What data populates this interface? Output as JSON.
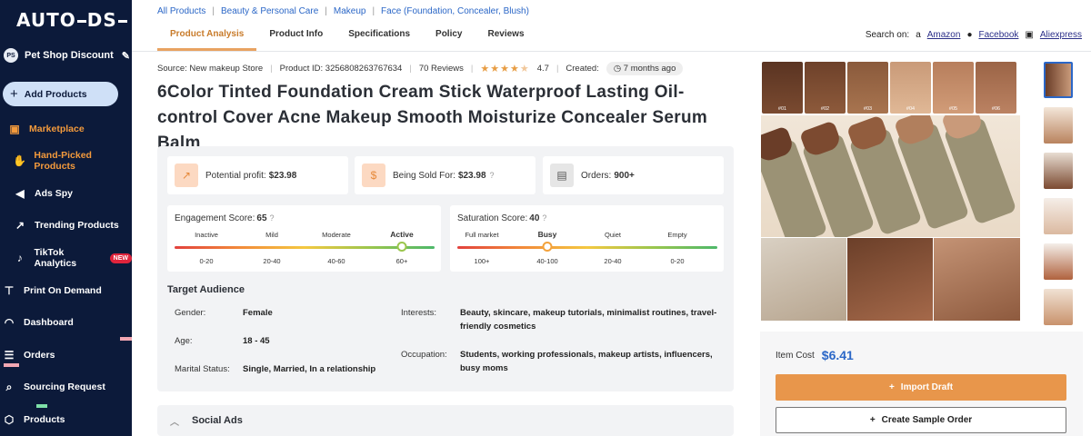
{
  "sidebar": {
    "logo_a": "AUTO",
    "logo_b": "DS",
    "store_badge": "PS",
    "store_name": "Pet Shop Discount",
    "add_products": "Add Products",
    "items": [
      {
        "label": "Marketplace",
        "icon": "bag-icon"
      },
      {
        "label": "Hand-Picked Products",
        "icon": "hand-icon"
      },
      {
        "label": "Ads Spy",
        "icon": "megaphone-icon"
      },
      {
        "label": "Trending Products",
        "icon": "trend-chart-icon"
      },
      {
        "label": "TikTok Analytics",
        "icon": "tiktok-icon",
        "badge": "NEW"
      },
      {
        "label": "Print On Demand",
        "icon": "shirt-icon"
      },
      {
        "label": "Dashboard",
        "icon": "gauge-icon"
      },
      {
        "label": "Orders",
        "icon": "orders-icon"
      },
      {
        "label": "Sourcing Request",
        "icon": "sourcing-icon"
      },
      {
        "label": "Products",
        "icon": "box-icon"
      }
    ]
  },
  "breadcrumb": [
    "All Products",
    "Beauty & Personal Care",
    "Makeup",
    "Face (Foundation, Concealer, Blush)"
  ],
  "tabs": [
    "Product Analysis",
    "Product Info",
    "Specifications",
    "Policy",
    "Reviews"
  ],
  "search_on": {
    "label": "Search on:",
    "sites": [
      "Amazon",
      "Facebook",
      "Aliexpress"
    ]
  },
  "meta": {
    "source": "Source: New makeup Store",
    "product_id": "Product ID: 3256808263767634",
    "reviews": "70 Reviews",
    "rating": "4.7",
    "created_label": "Created:",
    "created_value": "7 months ago"
  },
  "title": "6Color Tinted Foundation Cream Stick Waterproof Lasting Oil-control Cover Acne Makeup Smooth Moisturize Concealer Serum Balm",
  "metrics": {
    "profit_label": "Potential profit:",
    "profit_value": "$23.98",
    "sold_label": "Being Sold For:",
    "sold_value": "$23.98",
    "orders_label": "Orders:",
    "orders_value": "900+"
  },
  "engagement": {
    "label": "Engagement Score:",
    "value": "65",
    "levels": [
      "Inactive",
      "Mild",
      "Moderate",
      "Active"
    ],
    "ranges": [
      "0-20",
      "20-40",
      "40-60",
      "60+"
    ],
    "active_index": 3
  },
  "saturation": {
    "label": "Saturation Score:",
    "value": "40",
    "levels": [
      "Full market",
      "Busy",
      "Quiet",
      "Empty"
    ],
    "ranges": [
      "100+",
      "40-100",
      "20-40",
      "0-20"
    ],
    "active_index": 1
  },
  "audience": {
    "title": "Target Audience",
    "gender_label": "Gender:",
    "gender": "Female",
    "age_label": "Age:",
    "age": "18 - 45",
    "marital_label": "Marital Status:",
    "marital": "Single, Married, In a relationship",
    "interests_label": "Interests:",
    "interests_1": "Beauty, skincare, makeup tutorials, minimalist routines, travel-",
    "interests_2": "friendly cosmetics",
    "occupation_label": "Occupation:",
    "occupation_1": "Students, working professionals, makeup artists, influencers,",
    "occupation_2": "busy moms"
  },
  "social_ads": "Social Ads",
  "shades": [
    "#01",
    "#02",
    "#03",
    "#04",
    "#05",
    "#06"
  ],
  "item_cost_label": "Item Cost",
  "item_cost": "$6.41",
  "import_draft": "Import Draft",
  "create_sample": "Create Sample Order"
}
